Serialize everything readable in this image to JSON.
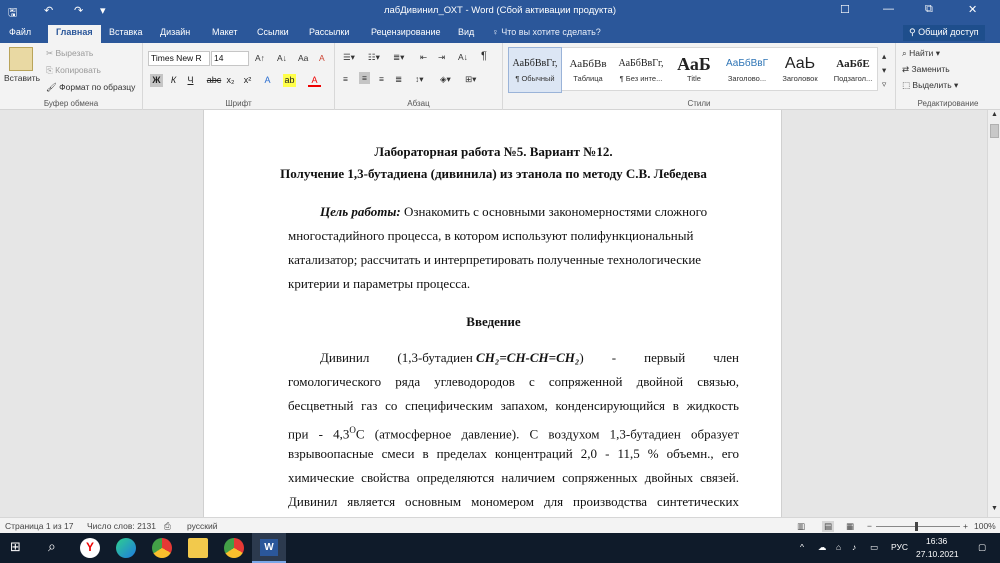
{
  "window": {
    "title": "лабДивинил_ОХТ - Word (Сбой активации продукта)",
    "min": "—",
    "max": "☐",
    "close": "✕",
    "restore": "⧉"
  },
  "qat": {
    "save": "🖫",
    "undo": "↶",
    "redo": "↷",
    "more": "▾"
  },
  "tabs": [
    "Файл",
    "Главная",
    "Вставка",
    "Дизайн",
    "Макет",
    "Ссылки",
    "Рассылки",
    "Рецензирование",
    "Вид"
  ],
  "active_tab": "Главная",
  "tellme": "Что вы хотите сделать?",
  "share": "Общий доступ",
  "clipboard": {
    "paste": "Вставить",
    "cut": "Вырезать",
    "copy": "Копировать",
    "format_painter": "Формат по образцу",
    "label": "Буфер обмена"
  },
  "font": {
    "name": "Times New R",
    "size": "14",
    "bold": "Ж",
    "italic": "К",
    "underline": "Ч",
    "strike": "abc",
    "sub": "x₂",
    "sup": "x²",
    "grow": "A↑",
    "shrink": "A↓",
    "case": "Aa",
    "clear": "A",
    "effects": "A",
    "highlight": "ab",
    "color": "A",
    "label": "Шрифт"
  },
  "paragraph": {
    "label": "Абзац",
    "pilcrow": "¶",
    "sort": "A↓"
  },
  "styles": {
    "label": "Стили",
    "items": [
      {
        "preview": "АаБбВвГг,",
        "name": "¶ Обычный"
      },
      {
        "preview": "АаБбВв",
        "name": "Таблица"
      },
      {
        "preview": "АаБбВвГг,",
        "name": "¶ Без инте..."
      },
      {
        "preview": "АаБ",
        "name": "Title"
      },
      {
        "preview": "АаБбВвГ",
        "name": "Заголово..."
      },
      {
        "preview": "АаЬ",
        "name": "Заголовок"
      },
      {
        "preview": "АаБбЕ",
        "name": "Подзагол..."
      }
    ]
  },
  "editing": {
    "find": "Найти",
    "replace": "Заменить",
    "select": "Выделить",
    "label": "Редактирование"
  },
  "doc": {
    "h1": "Лабораторная работа №5. Вариант №12.",
    "h2": "Получение 1,3-бутадиена (дивинила) из этанола по методу С.В. Лебедева",
    "goal_label": "Цель работы:",
    "goal_l1": " Ознакомить с основными закономерностями сложного",
    "goal_l2": "многостадийного процесса, в котором используют полифункциональный",
    "goal_l3": "катализатор; рассчитать и интерпретировать полученные технологические",
    "goal_l4": "критерии и параметры процесса.",
    "intro": "Введение",
    "p1a": "Дивинил (1,3-бутадиен ",
    "formula": "CH₂=CH-CH=CH₂",
    "p1b": ") - первый член",
    "l2": "гомологического ряда углеводородов с сопряженной двойной связью,",
    "l3": "бесцветный газ со специфическим запахом, конденсирующийся в жидкость",
    "l4a": "при - 4,3",
    "deg": "O",
    "l4b": "С (атмосферное давление). С воздухом 1,3-бутадиен образует",
    "l5": "взрывоопасные смеси в пределах концентраций 2,0 - 11,5 % объемн., его",
    "l6": "химические свойства определяются наличием сопряженных двойных связей.",
    "l7": "Дивинил является основным мономером для производства синтетических"
  },
  "status": {
    "page": "Страница 1 из 17",
    "words": "Число слов: 2131",
    "lang": "русский",
    "zoom": "100%"
  },
  "taskbar": {
    "lang": "РУС",
    "time": "16:36",
    "date": "27.10.2021"
  }
}
